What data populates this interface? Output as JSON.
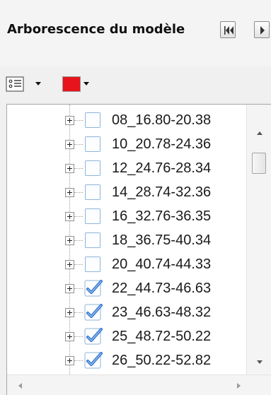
{
  "header": {
    "title": "Arborescence du modèle",
    "buttons": [
      {
        "name": "first-icon"
      },
      {
        "name": "next-icon"
      }
    ]
  },
  "toolbar": {
    "view_icon": "list-options-icon",
    "color": "#e8141c"
  },
  "tree": {
    "items": [
      {
        "label": "08_16.80-20.38",
        "checked": false
      },
      {
        "label": "10_20.78-24.36",
        "checked": false
      },
      {
        "label": "12_24.76-28.34",
        "checked": false
      },
      {
        "label": "14_28.74-32.36",
        "checked": false
      },
      {
        "label": "16_32.76-36.35",
        "checked": false
      },
      {
        "label": "18_36.75-40.34",
        "checked": false
      },
      {
        "label": "20_40.74-44.33",
        "checked": false
      },
      {
        "label": "22_44.73-46.63",
        "checked": true
      },
      {
        "label": "23_46.63-48.32",
        "checked": true
      },
      {
        "label": "25_48.72-50.22",
        "checked": true
      },
      {
        "label": "26_50.22-52.82",
        "checked": true
      }
    ]
  },
  "scrollbars": {
    "vertical_position": 0.1,
    "horizontal_position": 0
  }
}
